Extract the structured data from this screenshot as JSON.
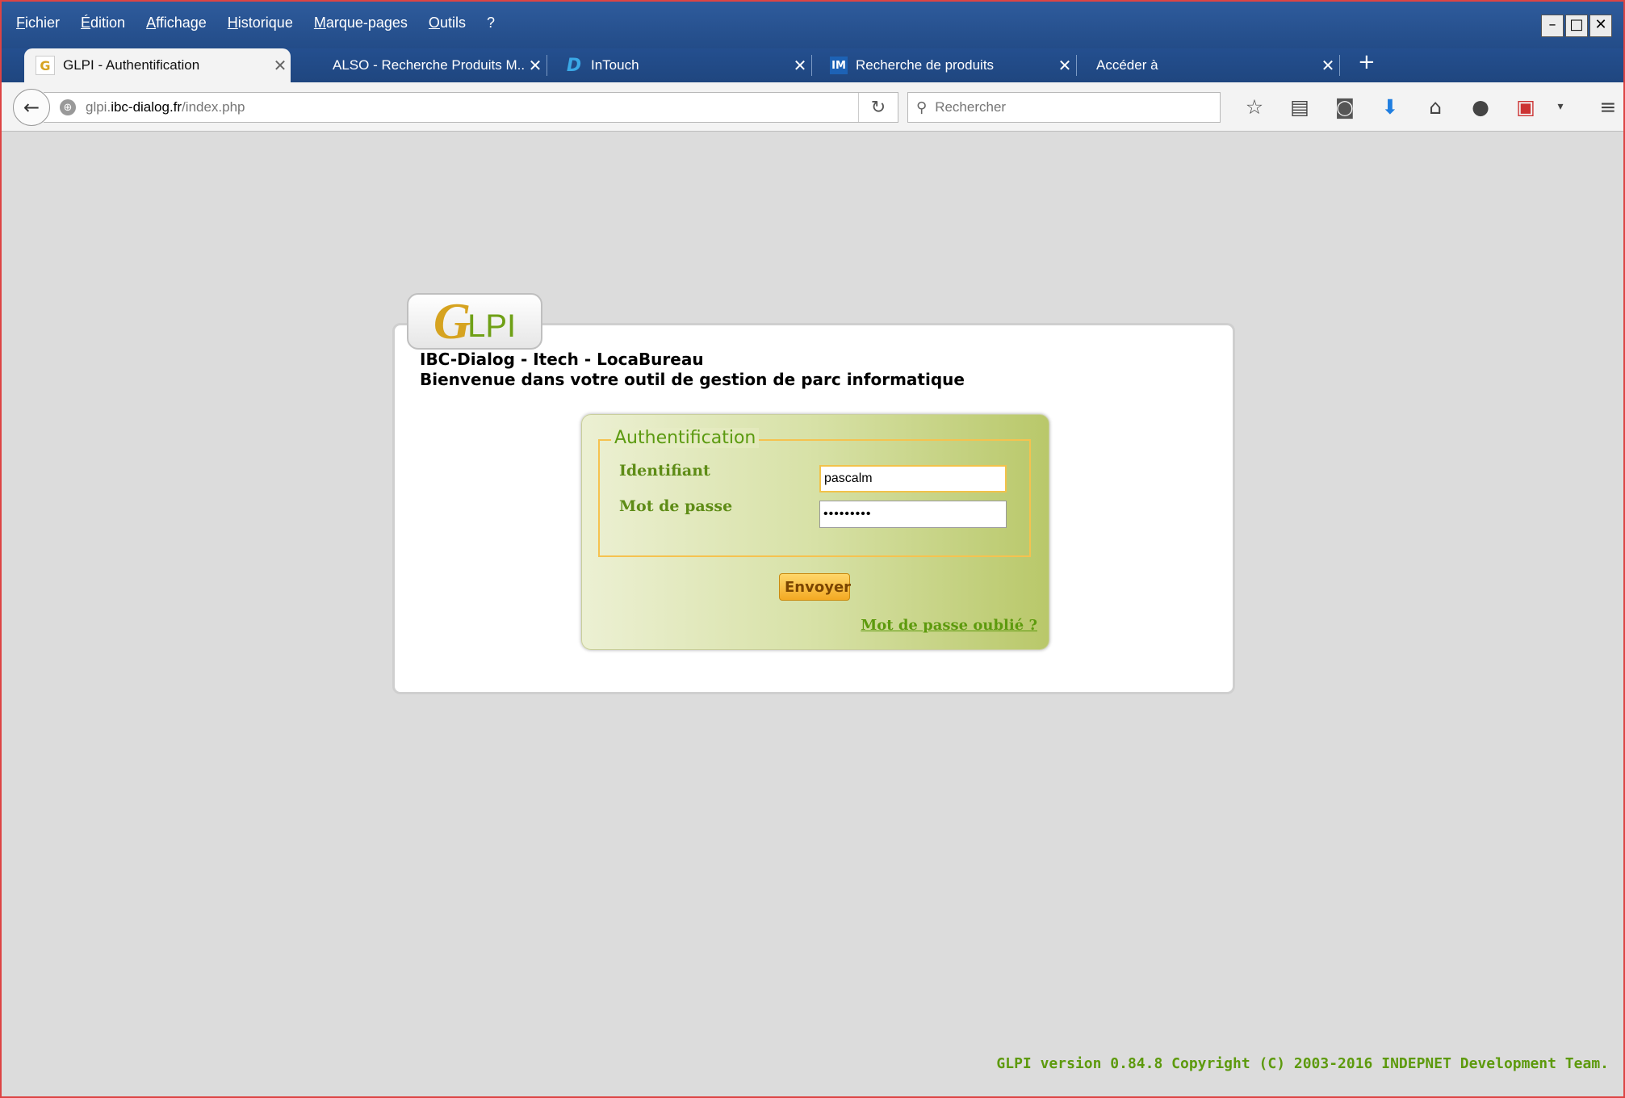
{
  "menu": {
    "items": [
      "Fichier",
      "Édition",
      "Affichage",
      "Historique",
      "Marque-pages",
      "Outils",
      "?"
    ]
  },
  "tabs": [
    {
      "label": "GLPI - Authentification",
      "icon": "glpi-g-icon",
      "active": true
    },
    {
      "label": "ALSO - Recherche Produits M...",
      "icon": "none"
    },
    {
      "label": "InTouch",
      "icon": "intouch-d-icon"
    },
    {
      "label": "Recherche de produits",
      "icon": "im-icon"
    },
    {
      "label": "Accéder à",
      "icon": "none"
    }
  ],
  "navbar": {
    "url_prefix": "glpi.",
    "url_domain": "ibc-dialog.fr",
    "url_path": "/index.php",
    "search_placeholder": "Rechercher"
  },
  "page": {
    "logo_text_g": "G",
    "logo_text_lpi": "LPI",
    "org_line": "IBC-Dialog - Itech - LocaBureau",
    "welcome_line": "Bienvenue dans votre outil de gestion de parc informatique",
    "login": {
      "legend": "Authentification",
      "username_label": "Identifiant",
      "username_value": "pascalm",
      "password_label": "Mot de passe",
      "password_value": "•••••••••",
      "submit_label": "Envoyer",
      "forgot_label": "Mot de passe oublié ?"
    },
    "footer": "GLPI version 0.84.8 Copyright (C) 2003-2016 INDEPNET Development Team."
  },
  "colors": {
    "accent_green": "#5d9a0d",
    "button_orange": "#f3a923",
    "fieldset_border": "#f6c24f",
    "titlebar_blue": "#2e5b9c"
  }
}
